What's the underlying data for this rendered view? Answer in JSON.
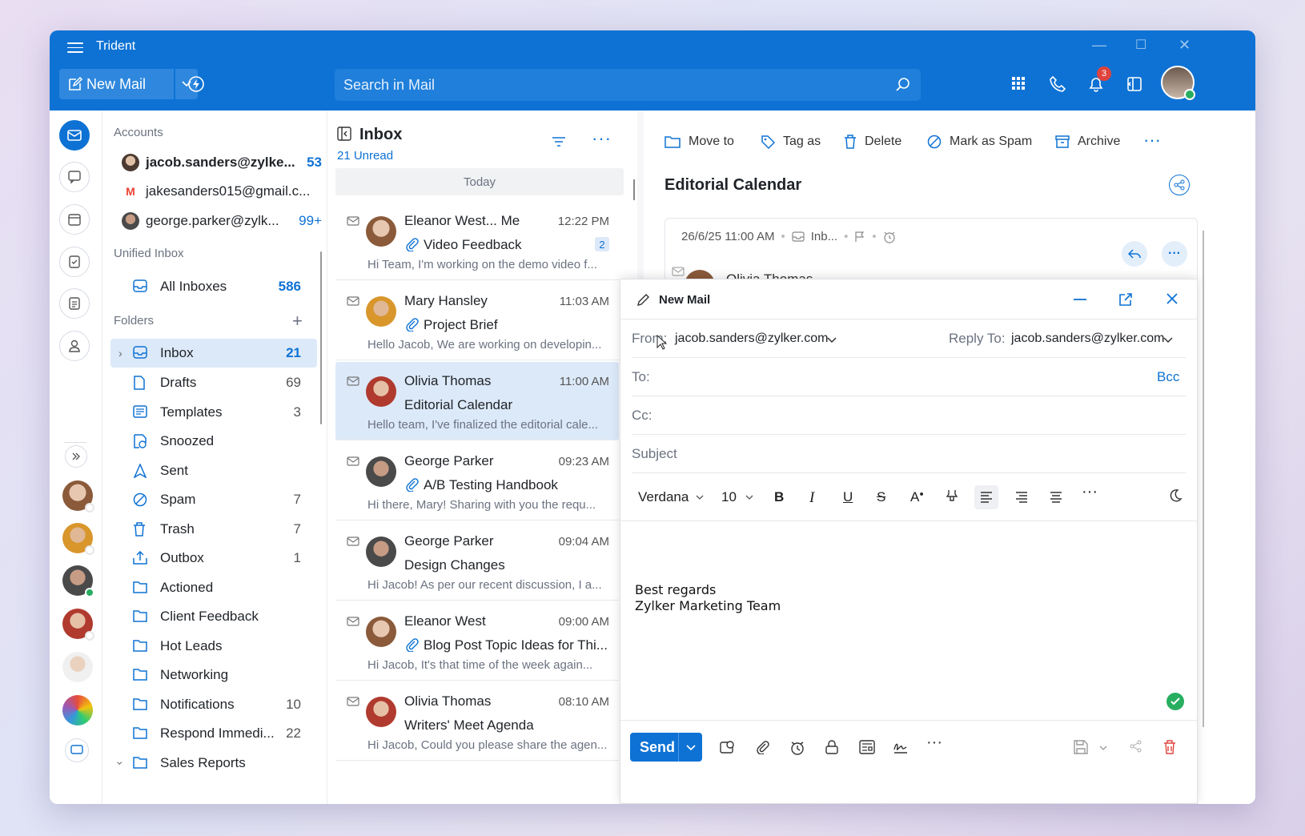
{
  "app": {
    "title": "Trident"
  },
  "toolbar": {
    "new_mail": "New Mail",
    "search_placeholder": "Search in Mail",
    "notifications_count": "3"
  },
  "accounts": {
    "title": "Accounts",
    "items": [
      {
        "email": "jacob.sanders@zylke...",
        "count": "53",
        "bold": true
      },
      {
        "email": "jakesanders015@gmail.c...",
        "count": ""
      },
      {
        "email": "george.parker@zylk...",
        "count": "99+"
      }
    ]
  },
  "unified": {
    "title": "Unified Inbox",
    "all_inboxes": "All Inboxes",
    "all_count": "586"
  },
  "folders": {
    "title": "Folders",
    "items": [
      {
        "label": "Inbox",
        "count": "21"
      },
      {
        "label": "Drafts",
        "count": "69"
      },
      {
        "label": "Templates",
        "count": "3"
      },
      {
        "label": "Snoozed",
        "count": ""
      },
      {
        "label": "Sent",
        "count": ""
      },
      {
        "label": "Spam",
        "count": "7"
      },
      {
        "label": "Trash",
        "count": "7"
      },
      {
        "label": "Outbox",
        "count": "1"
      },
      {
        "label": "Actioned",
        "count": ""
      },
      {
        "label": "Client Feedback",
        "count": ""
      },
      {
        "label": "Hot Leads",
        "count": ""
      },
      {
        "label": "Networking",
        "count": ""
      },
      {
        "label": "Notifications",
        "count": "10"
      },
      {
        "label": "Respond Immedi...",
        "count": "22"
      },
      {
        "label": "Sales Reports",
        "count": ""
      }
    ]
  },
  "list": {
    "title": "Inbox",
    "unread": "21 Unread",
    "group": "Today",
    "mails": [
      {
        "from": "Eleanor West... Me",
        "time": "12:22 PM",
        "subject": "Video Feedback",
        "attach": true,
        "badge": "2",
        "preview": "Hi Team, I'm working on the demo video f..."
      },
      {
        "from": "Mary Hansley",
        "time": "11:03 AM",
        "subject": "Project Brief",
        "attach": true,
        "preview": "Hello Jacob, We are working on developin..."
      },
      {
        "from": "Olivia Thomas",
        "time": "11:00 AM",
        "subject": "Editorial Calendar",
        "attach": false,
        "preview": "Hello team, I've finalized the editorial cale..."
      },
      {
        "from": "George Parker",
        "time": "09:23 AM",
        "subject": "A/B Testing Handbook",
        "attach": true,
        "preview": "Hi there, Mary! Sharing with you the requ..."
      },
      {
        "from": "George Parker",
        "time": "09:04 AM",
        "subject": "Design Changes",
        "attach": false,
        "preview": "Hi Jacob! As per our recent discussion, I a..."
      },
      {
        "from": "Eleanor West",
        "time": "09:00 AM",
        "subject": "Blog Post Topic Ideas for Thi...",
        "attach": true,
        "preview": "Hi Jacob, It's that time of the week again..."
      },
      {
        "from": "Olivia Thomas",
        "time": "08:10 AM",
        "subject": "Writers' Meet Agenda",
        "attach": false,
        "preview": "Hi Jacob, Could you please share the agen..."
      }
    ]
  },
  "reader": {
    "actions": {
      "move": "Move to",
      "tag": "Tag as",
      "delete": "Delete",
      "spam": "Mark as Spam",
      "archive": "Archive"
    },
    "title": "Editorial Calendar",
    "date": "26/6/25 11:00 AM",
    "folder": "Inb...",
    "sender_partial": "Olivia Thomas"
  },
  "compose": {
    "title": "New Mail",
    "from_label": "From:",
    "from": "jacob.sanders@zylker.com",
    "reply_label": "Reply To:",
    "reply_to": "jacob.sanders@zylker.com",
    "to_label": "To:",
    "bcc": "Bcc",
    "cc_label": "Cc:",
    "subject_placeholder": "Subject",
    "font": "Verdana",
    "size": "10",
    "signature_line1": "Best regards",
    "signature_line2": "Zylker Marketing Team",
    "send": "Send"
  }
}
